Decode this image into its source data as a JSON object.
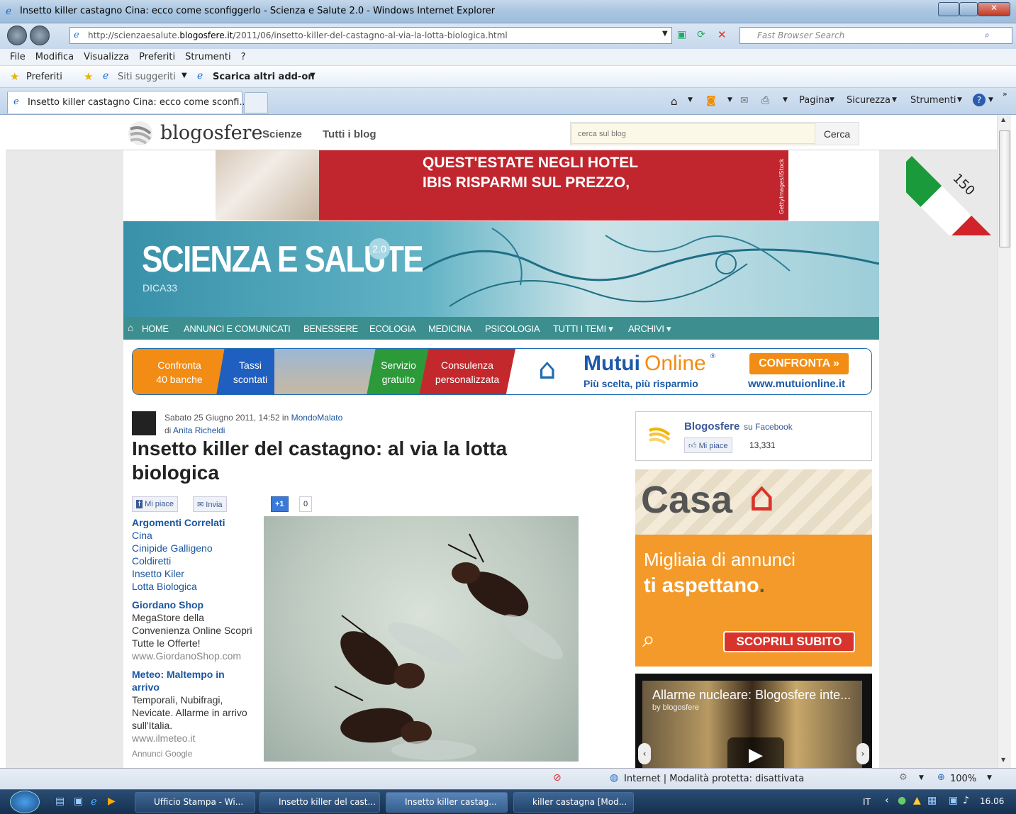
{
  "window": {
    "title": "Insetto killer castagno Cina: ecco come sconfiggerlo - Scienza e Salute 2.0 - Windows Internet Explorer"
  },
  "addressbar": {
    "url_prefix": "http://scienzaesalute.",
    "url_domain": "blogosfere.it",
    "url_path": "/2011/06/insetto-killer-del-castagno-al-via-la-lotta-biologica.html",
    "search_placeholder": "Fast Browser Search"
  },
  "menu": [
    "File",
    "Modifica",
    "Visualizza",
    "Preferiti",
    "Strumenti",
    "?"
  ],
  "favorites": {
    "label": "Preferiti",
    "suggested": "Siti suggeriti",
    "addons": "Scarica altri add-on"
  },
  "tab": {
    "label": "Insetto killer castagno Cina: ecco come sconfi..."
  },
  "commandbar": {
    "page": "Pagina",
    "security": "Sicurezza",
    "tools": "Strumenti"
  },
  "blog": {
    "logo": "blogosfere",
    "nav1": "Scienze",
    "nav2": "Tutti i blog",
    "search_placeholder": "cerca sul blog",
    "search_button": "Cerca",
    "badge": "150"
  },
  "ads": {
    "hotel_line1": "QUEST'ESTATE NEGLI HOTEL",
    "hotel_line2": "IBIS RISPARMI SUL PREZZO,",
    "hotel_credit": "GettyImages/iStock",
    "mutui": {
      "s1a": "Confronta",
      "s1b": "40 banche",
      "s2a": "Tassi",
      "s2b": "scontati",
      "s3a": "Servizio",
      "s3b": "gratuito",
      "s4a": "Consulenza",
      "s4b": "personalizzata",
      "brand1": "Mutui",
      "brand2": "Online",
      "reg": "®",
      "tagline": "Più scelta, più risparmio",
      "cta": "CONFRONTA »",
      "url": "www.mutuionline.it"
    },
    "casa": {
      "title": "Casa",
      "line1": "Migliaia di annunci",
      "line2": "ti aspettano",
      "dot": ".",
      "cta": "SCOPRILI SUBITO"
    }
  },
  "header": {
    "title": "SCIENZA E SALUTE",
    "version": "2.0",
    "subtitle": "DICA33"
  },
  "nav": [
    "HOME",
    "ANNUNCI E COMUNICATI",
    "BENESSERE",
    "ECOLOGIA",
    "MEDICINA",
    "PSICOLOGIA",
    "TUTTI I TEMI ▾",
    "ARCHIVI ▾"
  ],
  "article": {
    "date": "Sabato 25 Giugno 2011, 14:52 in ",
    "category": "MondoMalato",
    "by": "di ",
    "author": "Anita Richeldi",
    "title": "Insetto killer del castagno: al via la lotta biologica",
    "like": "Mi piace",
    "send": "Invia",
    "plus": "+1",
    "plus_count": "0"
  },
  "sidebar": {
    "related_heading": "Argomenti Correlati",
    "related": [
      "Cina",
      "Cinipide Galligeno",
      "Coldiretti",
      "Insetto Kiler",
      "Lotta Biologica"
    ],
    "ad1": {
      "title": "Giordano Shop",
      "text": "MegaStore della Convenienza Online Scopri Tutte le Offerte!",
      "url": "www.GiordanoShop.com"
    },
    "ad2": {
      "title": "Meteo: Maltempo in arrivo",
      "text": "Temporali, Nubifragi, Nevicate. Allarme in arrivo sull'Italia.",
      "url": "www.ilmeteo.it"
    },
    "more": "Annunci Google"
  },
  "facebook": {
    "name": "Blogosfere",
    "suffix": " su Facebook",
    "like": "Mi piace",
    "count": "13,331"
  },
  "video": {
    "title": "Allarme nucleare: Blogosfere inte...",
    "by": "by blogosfere"
  },
  "statusbar": {
    "zone": "Internet | Modalità protetta: disattivata",
    "zoom": "100%"
  },
  "taskbar": {
    "items": [
      "Ufficio Stampa - Wi...",
      "Insetto killer del cast...",
      "Insetto killer castag...",
      "killer castagna [Mod..."
    ],
    "lang": "IT",
    "time": "16.06"
  },
  "colors": {
    "accent": "#3d8f8f",
    "link": "#1a55a0",
    "ad_red": "#c1262f",
    "casa_orange": "#f39a2a"
  }
}
